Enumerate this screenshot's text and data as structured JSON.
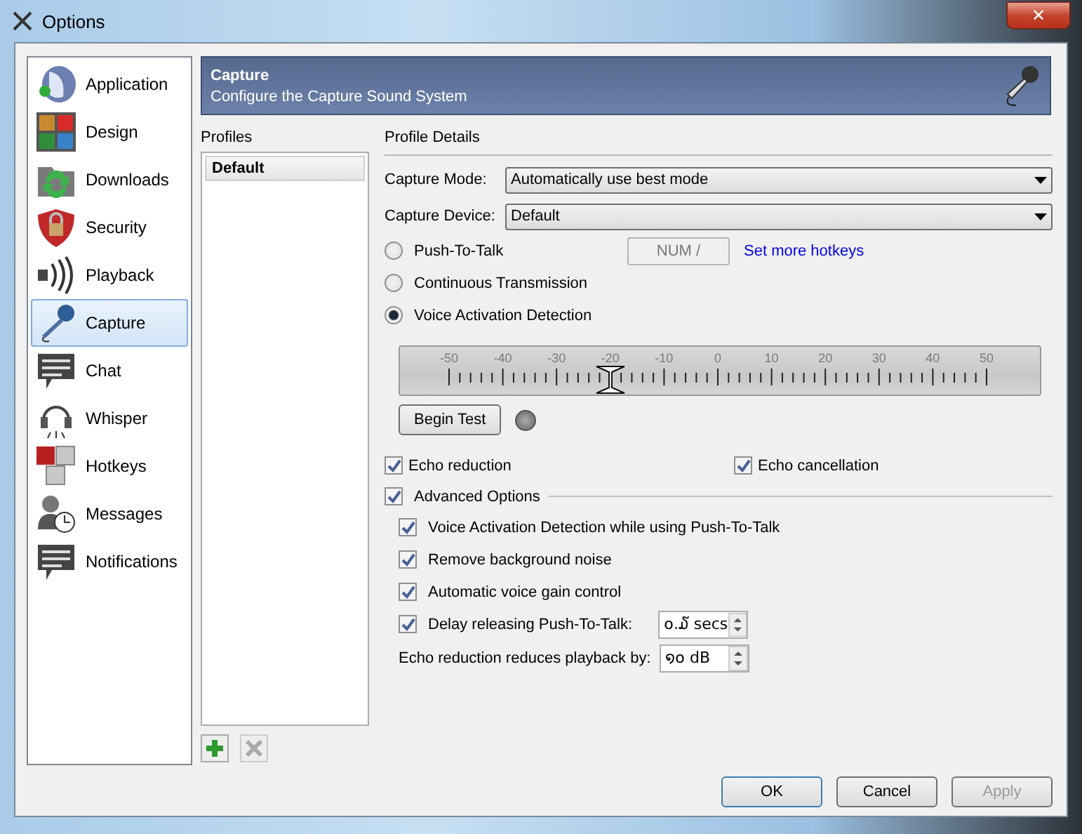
{
  "window": {
    "title": "Options",
    "close": "✕"
  },
  "sidebar": {
    "items": [
      {
        "label": "Application",
        "selected": false
      },
      {
        "label": "Design",
        "selected": false
      },
      {
        "label": "Downloads",
        "selected": false
      },
      {
        "label": "Security",
        "selected": false
      },
      {
        "label": "Playback",
        "selected": false
      },
      {
        "label": "Capture",
        "selected": true
      },
      {
        "label": "Chat",
        "selected": false
      },
      {
        "label": "Whisper",
        "selected": false
      },
      {
        "label": "Hotkeys",
        "selected": false
      },
      {
        "label": "Messages",
        "selected": false
      },
      {
        "label": "Notifications",
        "selected": false
      }
    ]
  },
  "header": {
    "title": "Capture",
    "subtitle": "Configure the Capture Sound System"
  },
  "profiles": {
    "label": "Profiles",
    "items": [
      {
        "label": "Default",
        "selected": true
      }
    ]
  },
  "details": {
    "label": "Profile Details",
    "capture_mode": {
      "label": "Capture Mode:",
      "value": "Automatically use best mode"
    },
    "capture_device": {
      "label": "Capture Device:",
      "value": "Default"
    },
    "modes": [
      {
        "label": "Push-To-Talk",
        "selected": false
      },
      {
        "label": "Continuous Transmission",
        "selected": false
      },
      {
        "label": "Voice Activation Detection",
        "selected": true
      }
    ],
    "hotkey": "NUM /",
    "hotkey_link": "Set more hotkeys",
    "threshold": {
      "ticks": [
        "-50",
        "-40",
        "-30",
        "-20",
        "-10",
        "0",
        "10",
        "20",
        "30",
        "40",
        "50"
      ],
      "level": 0.3
    },
    "begin_test": "Begin Test",
    "test_active": false,
    "echo": [
      {
        "label": "Echo reduction",
        "checked": true
      },
      {
        "label": "Echo cancellation",
        "checked": true
      }
    ],
    "advanced": {
      "label": "Advanced Options",
      "checked": true
    },
    "advanced_options": [
      {
        "label": "Voice Activation Detection while using Push-To-Talk",
        "checked": true
      },
      {
        "label": "Remove background noise",
        "checked": true
      },
      {
        "label": "Automatic voice gain control",
        "checked": true
      },
      {
        "label": "Delay releasing Push-To-Talk:",
        "checked": true,
        "value": "໐.໓ secs"
      }
    ],
    "echo_reduction": {
      "label": "Echo reduction reduces playback by:",
      "value": "໑໐ dB"
    }
  },
  "buttons": [
    {
      "label": "OK",
      "disabled": false,
      "default": true
    },
    {
      "label": "Cancel",
      "disabled": false,
      "default": false
    },
    {
      "label": "Apply",
      "disabled": true,
      "default": false
    }
  ]
}
